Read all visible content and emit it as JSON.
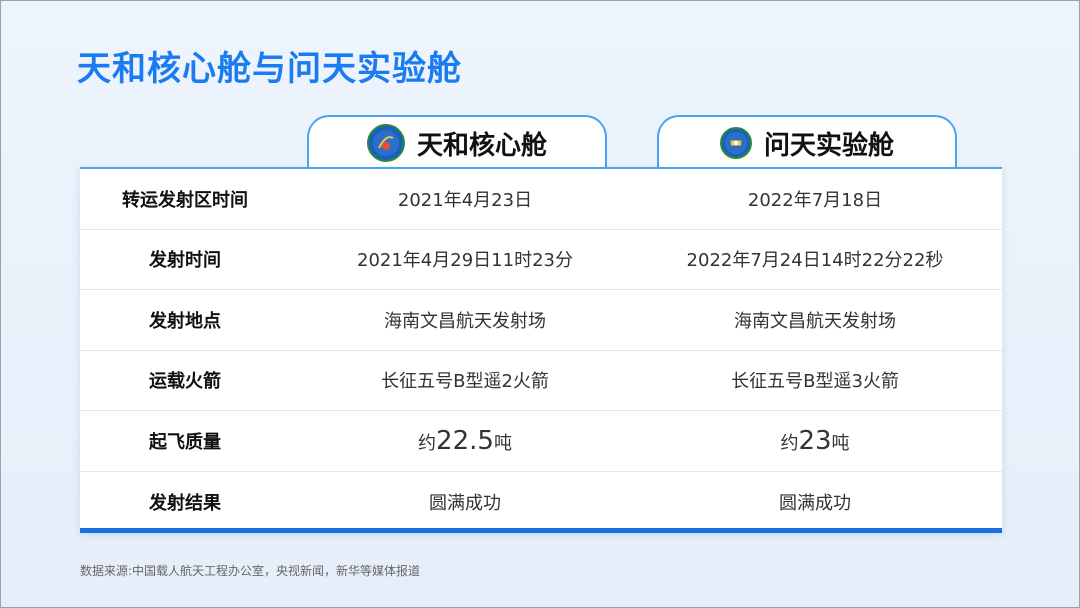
{
  "title": "天和核心舱与问天实验舱",
  "columns": [
    {
      "name": "天和核心舱",
      "icon": "mission-emblem-icon"
    },
    {
      "name": "问天实验舱",
      "icon": "mission-emblem-icon"
    }
  ],
  "rows": [
    {
      "label": "转运发射区时间",
      "v1": "2021年4月23日",
      "v2": "2022年7月18日"
    },
    {
      "label": "发射时间",
      "v1": "2021年4月29日11时23分",
      "v2": "2022年7月24日14时22分22秒"
    },
    {
      "label": "发射地点",
      "v1": "海南文昌航天发射场",
      "v2": "海南文昌航天发射场"
    },
    {
      "label": "运载火箭",
      "v1": "长征五号B型遥2火箭",
      "v2": "长征五号B型遥3火箭"
    },
    {
      "label": "起飞质量",
      "v1_pre": "约",
      "v1_num": "22.5",
      "v1_post": "吨",
      "v2_pre": "约",
      "v2_num": "23",
      "v2_post": "吨"
    },
    {
      "label": "发射结果",
      "v1": "圆满成功",
      "v2": "圆满成功"
    }
  ],
  "source": "数据来源:中国载人航天工程办公室，央视新闻，新华等媒体报道",
  "colors": {
    "accent": "#1a7cf0",
    "border": "#4aa3f3",
    "bottom_bar": "#1a6fe0"
  }
}
